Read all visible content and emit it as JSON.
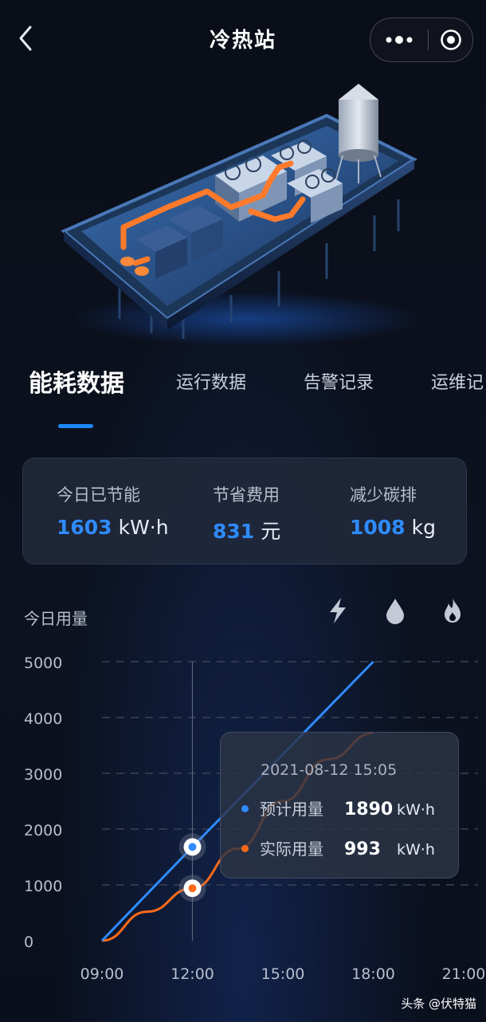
{
  "header": {
    "title": "冷热站",
    "back_icon": "chevron-left-icon",
    "more_icon": "more-dots-icon",
    "target_icon": "record-target-icon"
  },
  "tabs": [
    {
      "label": "能耗数据",
      "active": true
    },
    {
      "label": "运行数据",
      "active": false
    },
    {
      "label": "告警记录",
      "active": false
    },
    {
      "label": "运维记",
      "active": false
    }
  ],
  "savings": [
    {
      "label": "今日已节能",
      "value": "1603",
      "unit": "kW·h"
    },
    {
      "label": "节省费用",
      "value": "831",
      "unit": "元"
    },
    {
      "label": "减少碳排",
      "value": "1008",
      "unit": "kg"
    }
  ],
  "usage": {
    "title": "今日用量",
    "icons": [
      "lightning-icon",
      "water-drop-icon",
      "flame-icon"
    ]
  },
  "tooltip": {
    "time": "2021-08-12  15:05",
    "rows": [
      {
        "label": "预计用量",
        "value": "1890",
        "unit": "kW·h",
        "color": "#2f8bff"
      },
      {
        "label": "实际用量",
        "value": "993",
        "unit": "kW·h",
        "color": "#ff6a1a"
      }
    ]
  },
  "colors": {
    "accent": "#1e88ff",
    "expected": "#2f8bff",
    "actual": "#ff6a1a"
  },
  "chart_data": {
    "type": "line",
    "x": [
      "09:00",
      "12:00",
      "15:00",
      "18:00",
      "21:00"
    ],
    "yticks": [
      0,
      1000,
      2000,
      3000,
      4000,
      5000
    ],
    "ylim": [
      0,
      5000
    ],
    "series": [
      {
        "name": "预计用量",
        "color": "#2f8bff",
        "points": [
          [
            9,
            0
          ],
          [
            12,
            1680
          ],
          [
            18,
            5000
          ]
        ]
      },
      {
        "name": "实际用量",
        "color": "#ff6a1a",
        "points": [
          [
            9,
            0
          ],
          [
            10.5,
            520
          ],
          [
            12,
            940
          ],
          [
            13.5,
            1650
          ],
          [
            15,
            2500
          ],
          [
            16.5,
            3250
          ],
          [
            18,
            3720
          ]
        ]
      }
    ],
    "markers": [
      {
        "series": "预计用量",
        "x": 12,
        "y": 1680
      },
      {
        "series": "实际用量",
        "x": 12,
        "y": 940
      }
    ],
    "grid": true
  },
  "watermark": "头条 @伏特猫"
}
